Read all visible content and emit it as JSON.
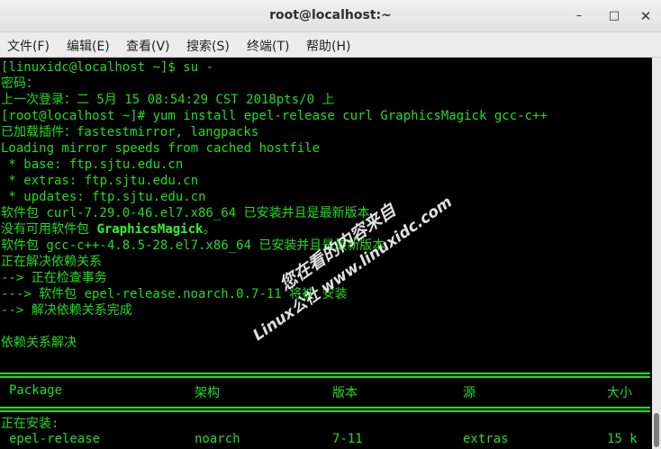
{
  "window": {
    "title": "root@localhost:~",
    "minimize_glyph": "–",
    "maximize_glyph": "□",
    "close_glyph": "✕"
  },
  "menu": {
    "items": [
      "文件(F)",
      "编辑(E)",
      "查看(V)",
      "搜索(S)",
      "终端(T)",
      "帮助(H)"
    ]
  },
  "terminal": {
    "lines": [
      "[linuxidc@localhost ~]$ su -",
      "密码：",
      "上一次登录：二 5月 15 08:54:29 CST 2018pts/0 上",
      "[root@localhost ~]# yum install epel-release curl GraphicsMagick gcc-c++",
      "已加载插件：fastestmirror, langpacks",
      "Loading mirror speeds from cached hostfile",
      " * base: ftp.sjtu.edu.cn",
      " * extras: ftp.sjtu.edu.cn",
      " * updates: ftp.sjtu.edu.cn",
      "软件包 curl-7.29.0-46.el7.x86_64 已安装并且是最新版本",
      "没有可用软件包 ",
      "软件包 gcc-c++-4.8.5-28.el7.x86_64 已安装并且是最新版本",
      "正在解决依赖关系",
      "--> 正在检查事务",
      "---> 软件包 epel-release.noarch.0.7-11 将被 安装",
      "--> 解决依赖关系完成",
      "",
      "依赖关系解决"
    ],
    "bold_package": "GraphicsMagick",
    "bold_suffix": "。",
    "table_headers": {
      "package": "Package",
      "arch": "架构",
      "version": "版本",
      "repo": "源",
      "size": "大小"
    },
    "installing_label": "正在安装:",
    "row": {
      "package": "epel-release",
      "arch": "noarch",
      "version": "7-11",
      "repo": "extras",
      "size": "15 k"
    }
  },
  "watermark": {
    "line1": "您在看的内容来自",
    "line2": "Linux公社 www.linuxidc.com"
  },
  "colors": {
    "terminal_fg": "#22dd22",
    "terminal_bg": "#000000",
    "titlebar_bg": "#e8e8e8"
  }
}
